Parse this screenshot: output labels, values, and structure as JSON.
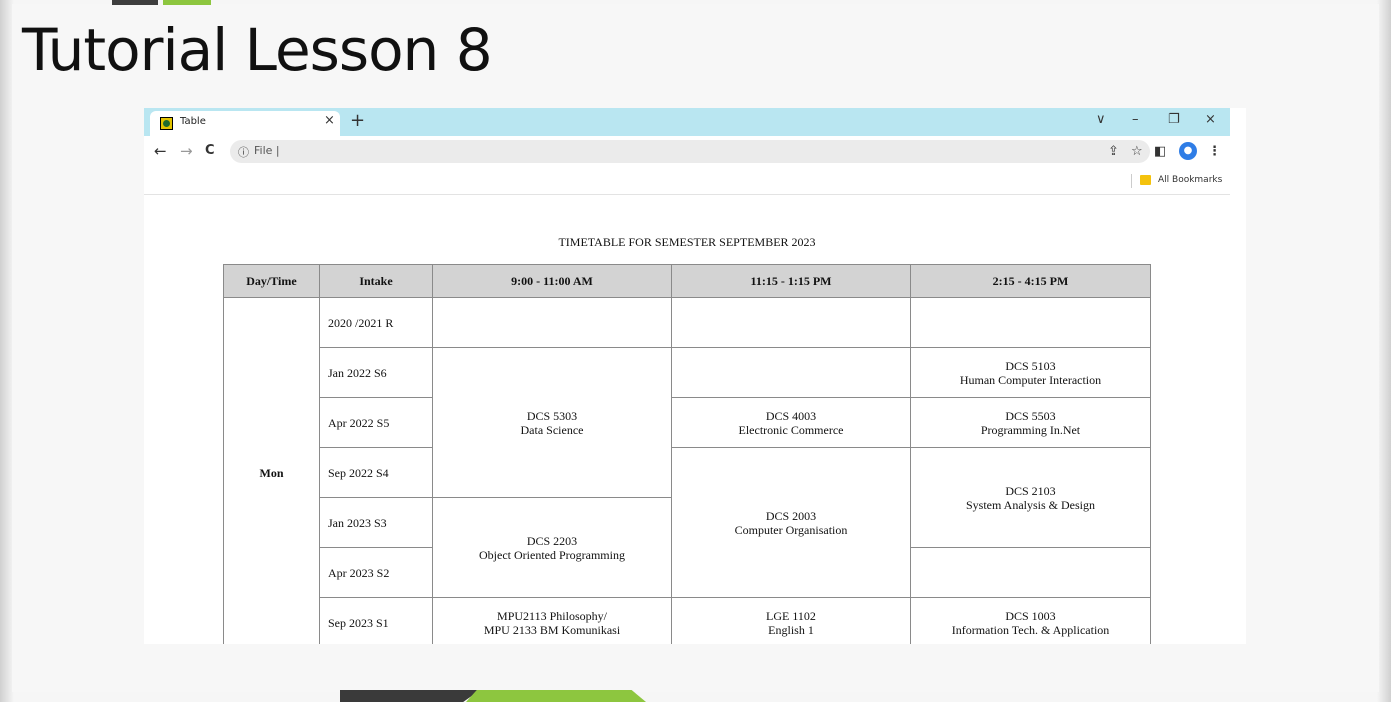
{
  "slide": {
    "title": "Tutorial Lesson 8"
  },
  "browser": {
    "tab_title": "Table",
    "tab_close": "×",
    "new_tab": "+",
    "window_controls": [
      "∨",
      "–",
      "❐",
      "×"
    ],
    "nav_back": "←",
    "nav_forward": "→",
    "nav_reload": "C",
    "address_icon": "ⓘ",
    "address_text": "File |",
    "toolbar_icons": [
      "share-icon",
      "star-icon",
      "sidepanel-icon",
      "avatar-icon",
      "menu-icon"
    ],
    "bookmarks_label": "All Bookmarks"
  },
  "page": {
    "heading": "TIMETABLE FOR SEMESTER SEPTEMBER 2023",
    "headers": [
      "Day/Time",
      "Intake",
      "9:00 - 11:00 AM",
      "11:15 - 1:15 PM",
      "2:15 - 4:15 PM"
    ],
    "day": "Mon",
    "intakes": [
      "2020 /2021 R",
      "Jan 2022 S6",
      "Apr 2022 S5",
      "Sep 2022 S4",
      "Jan 2023 S3",
      "Apr 2023 S2",
      "Sep 2023 S1"
    ],
    "cells": {
      "dcs5303_code": "DCS 5303",
      "dcs5303_name": "Data Science",
      "dcs2203_code": "DCS 2203",
      "dcs2203_name": "Object Oriented Programming",
      "mpu_line1": "MPU2113 Philosophy/",
      "mpu_line2": "MPU 2133 BM Komunikasi",
      "dcs4003_code": "DCS 4003",
      "dcs4003_name": "Electronic Commerce",
      "dcs2003_code": "DCS 2003",
      "dcs2003_name": "Computer Organisation",
      "lge1102_code": "LGE 1102",
      "lge1102_name": "English 1",
      "dcs5103_code": "DCS 5103",
      "dcs5103_name": "Human Computer Interaction",
      "dcs5503_code": "DCS 5503",
      "dcs5503_name": "Programming In.Net",
      "dcs2103_code": "DCS 2103",
      "dcs2103_name": "System Analysis & Design",
      "dcs1003_code": "DCS 1003",
      "dcs1003_name": "Information Tech. & Application"
    }
  },
  "colors": {
    "tabstrip": "#b9e6f1",
    "accent_green": "#8dc63f",
    "header_fill": "#d3d3d3"
  }
}
